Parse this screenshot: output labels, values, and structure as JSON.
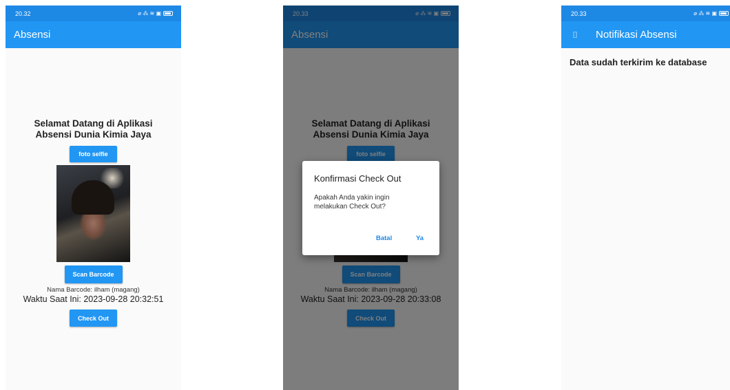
{
  "screen1": {
    "status_time": "20.32",
    "status_icons": "⌀ ⁂ ≋ ▣",
    "appbar_title": "Absensi",
    "welcome_line1": "Selamat Datang di Aplikasi",
    "welcome_line2": "Absensi Dunia Kimia Jaya",
    "foto_button": "foto selfie",
    "scan_button": "Scan Barcode",
    "nama_barcode": "Nama Barcode: ilham (magang)",
    "waktu": "Waktu Saat Ini: 2023-09-28 20:32:51",
    "checkout_button": "Check Out"
  },
  "screen2": {
    "status_time": "20.33",
    "status_icons": "⌀ ⁂ ≋ ▣",
    "appbar_title": "Absensi",
    "welcome_line1": "Selamat Datang di Aplikasi",
    "welcome_line2": "Absensi Dunia Kimia Jaya",
    "foto_button": "foto selfie",
    "scan_button": "Scan Barcode",
    "nama_barcode": "Nama Barcode: ilham (magang)",
    "waktu": "Waktu Saat Ini: 2023-09-28 20:33:08",
    "checkout_button": "Check Out",
    "dialog": {
      "title": "Konfirmasi Check Out",
      "message": "Apakah Anda yakin ingin melakukan Check Out?",
      "cancel": "Batal",
      "confirm": "Ya"
    }
  },
  "screen3": {
    "status_time": "20.33",
    "status_icons": "⌀ ⁂ ≋ ▣",
    "menu_icon": "⌷",
    "appbar_title": "Notifikasi Absensi",
    "message": "Data sudah terkirim ke database"
  }
}
